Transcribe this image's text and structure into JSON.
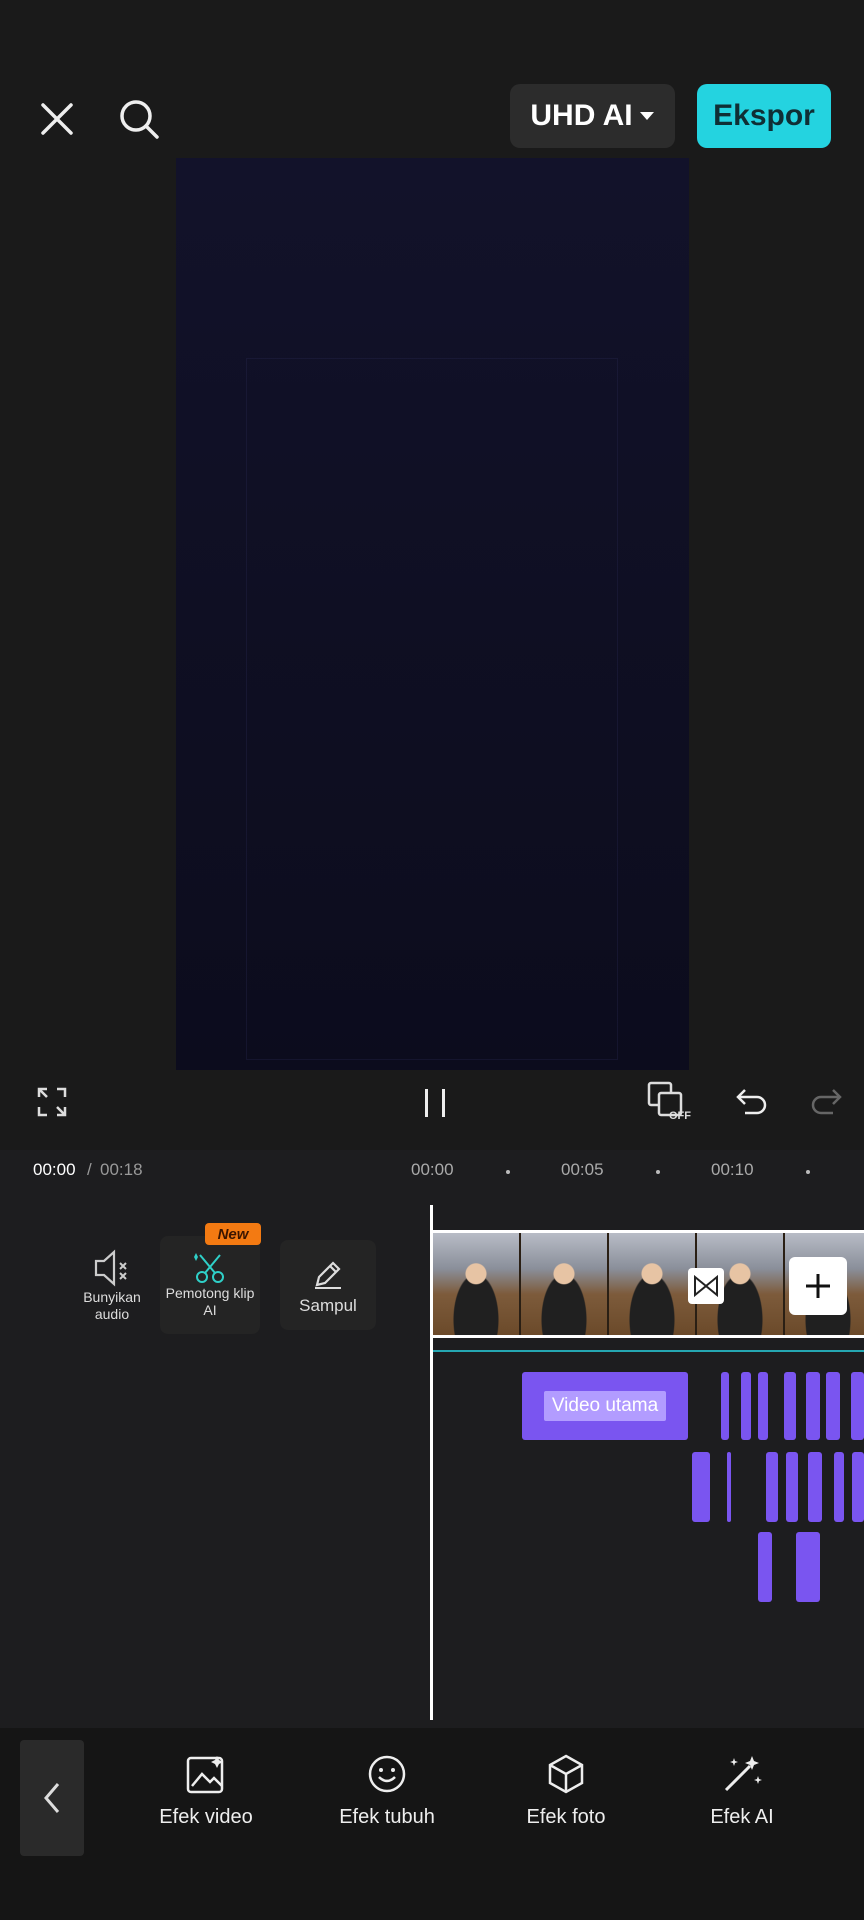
{
  "topbar": {
    "quality_label": "UHD AI",
    "export_label": "Ekspor",
    "accent_color": "#24d3e0"
  },
  "timeline": {
    "current_time": "00:00",
    "separator": "/",
    "total_time": "00:18",
    "ruler_labels": [
      "00:00",
      "00:05",
      "00:10"
    ]
  },
  "tools": {
    "audio_label": "Bunyikan audio",
    "ai_cut_label": "Pemotong klip AI",
    "new_badge": "New",
    "cover_label": "Sampul"
  },
  "tracks": {
    "main_effect_label": "Video utama",
    "effect_color": "#7a55f0"
  },
  "bottom_nav": {
    "items": [
      {
        "label": "Efek video",
        "icon": "video-effect-icon"
      },
      {
        "label": "Efek tubuh",
        "icon": "body-effect-icon"
      },
      {
        "label": "Efek foto",
        "icon": "photo-effect-icon"
      },
      {
        "label": "Efek AI",
        "icon": "ai-effect-icon"
      }
    ]
  }
}
